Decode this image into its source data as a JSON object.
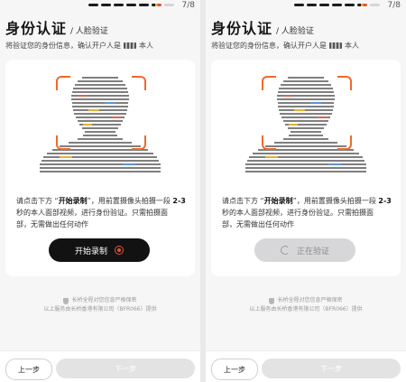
{
  "header": {
    "step_count": "7/8",
    "title": "身份认证",
    "subtitle": "/ 人脸验证",
    "hint_prefix": "将验证您的身份信息，确认开户人是",
    "hint_suffix": "本人"
  },
  "instructions": {
    "line1_a": "请点击下方 “",
    "line1_b": "开始录制",
    "line1_c": "”，用前置摄像头拍摄一段 ",
    "line1_d": "2-3",
    "line2": "秒的本人面部视频，进行身份验证。只需拍摄面",
    "line3": "部，无需做出任何动作"
  },
  "screen_left": {
    "primary_label": "开始录制",
    "primary_icon": "record-icon",
    "state": "idle"
  },
  "screen_right": {
    "primary_label": "正在验证",
    "primary_icon": "loading-icon",
    "state": "verifying"
  },
  "footer": {
    "line1": "长桥全程对您信息严格保密",
    "line2": "以上服务由长桥香港有限公司（BFR066）提供"
  },
  "nav": {
    "back_label": "上一步",
    "next_label": "下一步"
  },
  "colors": {
    "accent_orange": "#f06a2a",
    "button_dark": "#121212",
    "button_disabled": "#d7d7d9"
  }
}
